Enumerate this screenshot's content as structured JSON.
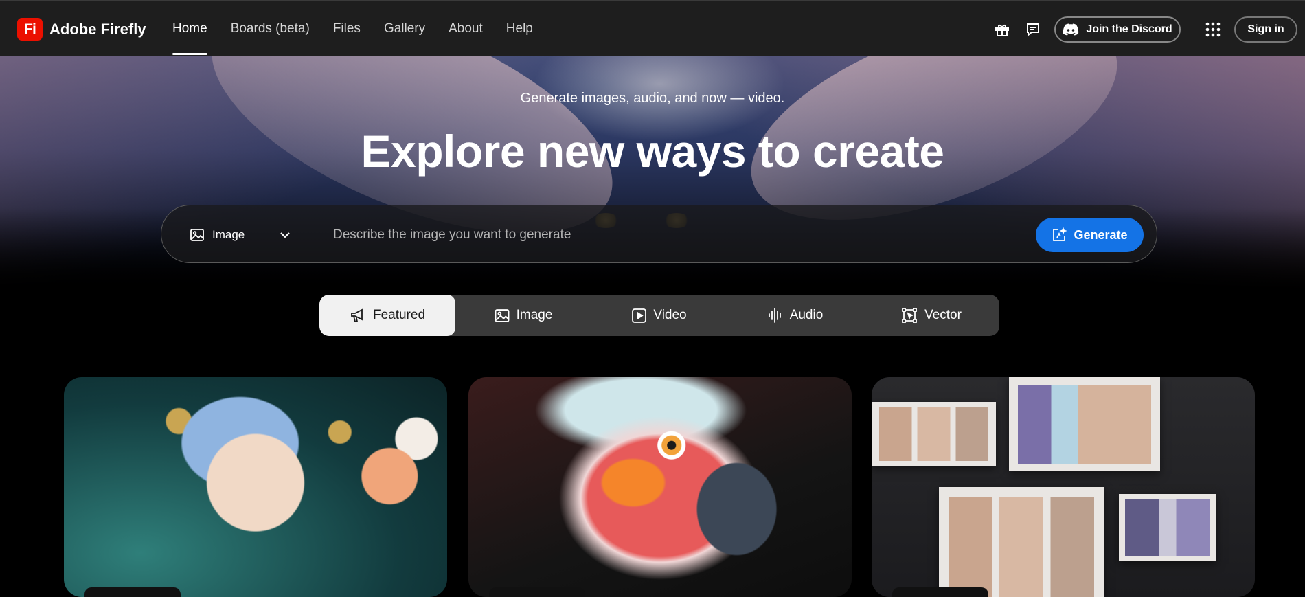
{
  "header": {
    "logo_mark": "Fi",
    "app_name": "Adobe Firefly",
    "nav": [
      {
        "label": "Home",
        "active": true
      },
      {
        "label": "Boards (beta)",
        "active": false
      },
      {
        "label": "Files",
        "active": false
      },
      {
        "label": "Gallery",
        "active": false
      },
      {
        "label": "About",
        "active": false
      },
      {
        "label": "Help",
        "active": false
      }
    ],
    "discord_label": "Join the Discord",
    "signin_label": "Sign in",
    "icons": [
      "gift-icon",
      "feedback-icon",
      "discord-icon",
      "app-grid-icon"
    ]
  },
  "hero": {
    "subtitle": "Generate images, audio, and now — video.",
    "title": "Explore new ways to create",
    "prompt": {
      "type_label": "Image",
      "placeholder": "Describe the image you want to generate",
      "value": "",
      "generate_label": "Generate"
    }
  },
  "tabs": [
    {
      "label": "Featured",
      "icon": "megaphone-icon",
      "active": true
    },
    {
      "label": "Image",
      "icon": "image-icon",
      "active": false
    },
    {
      "label": "Video",
      "icon": "video-icon",
      "active": false
    },
    {
      "label": "Audio",
      "icon": "audio-wave-icon",
      "active": false
    },
    {
      "label": "Vector",
      "icon": "vector-icon",
      "active": false
    }
  ],
  "colors": {
    "header_bg": "#1e1e1e",
    "accent": "#1473e6",
    "logo_red": "#eb1000",
    "tab_bar": "#3a3a3a",
    "tab_active": "#f1f1f1"
  }
}
